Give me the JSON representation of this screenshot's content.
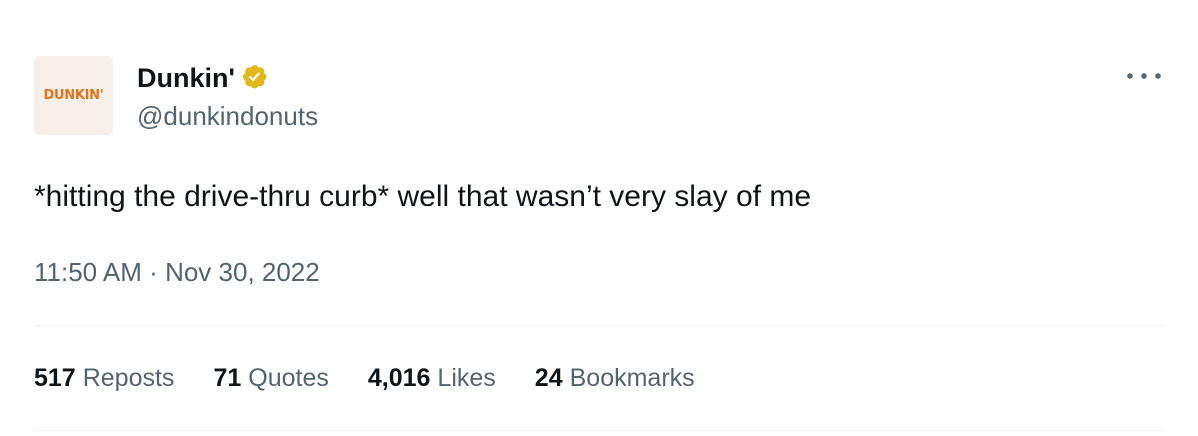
{
  "author": {
    "avatar_logo_text": "DUNKIN'",
    "display_name": "Dunkin'",
    "handle": "@dunkindonuts",
    "verified_badge_color": "#e2b719",
    "avatar_background": "#f6f0e9",
    "logo_color": "#e4721d"
  },
  "tweet": {
    "text": "*hitting the drive-thru curb* well that wasn’t very slay of me",
    "time": "11:50 AM",
    "separator": "·",
    "date": "Nov 30, 2022"
  },
  "stats": [
    {
      "count": "517",
      "label": "Reposts"
    },
    {
      "count": "71",
      "label": "Quotes"
    },
    {
      "count": "4,016",
      "label": "Likes"
    },
    {
      "count": "24",
      "label": "Bookmarks"
    }
  ],
  "icons": {
    "more": "more-horizontal-icon",
    "verified": "verified-badge-icon"
  }
}
